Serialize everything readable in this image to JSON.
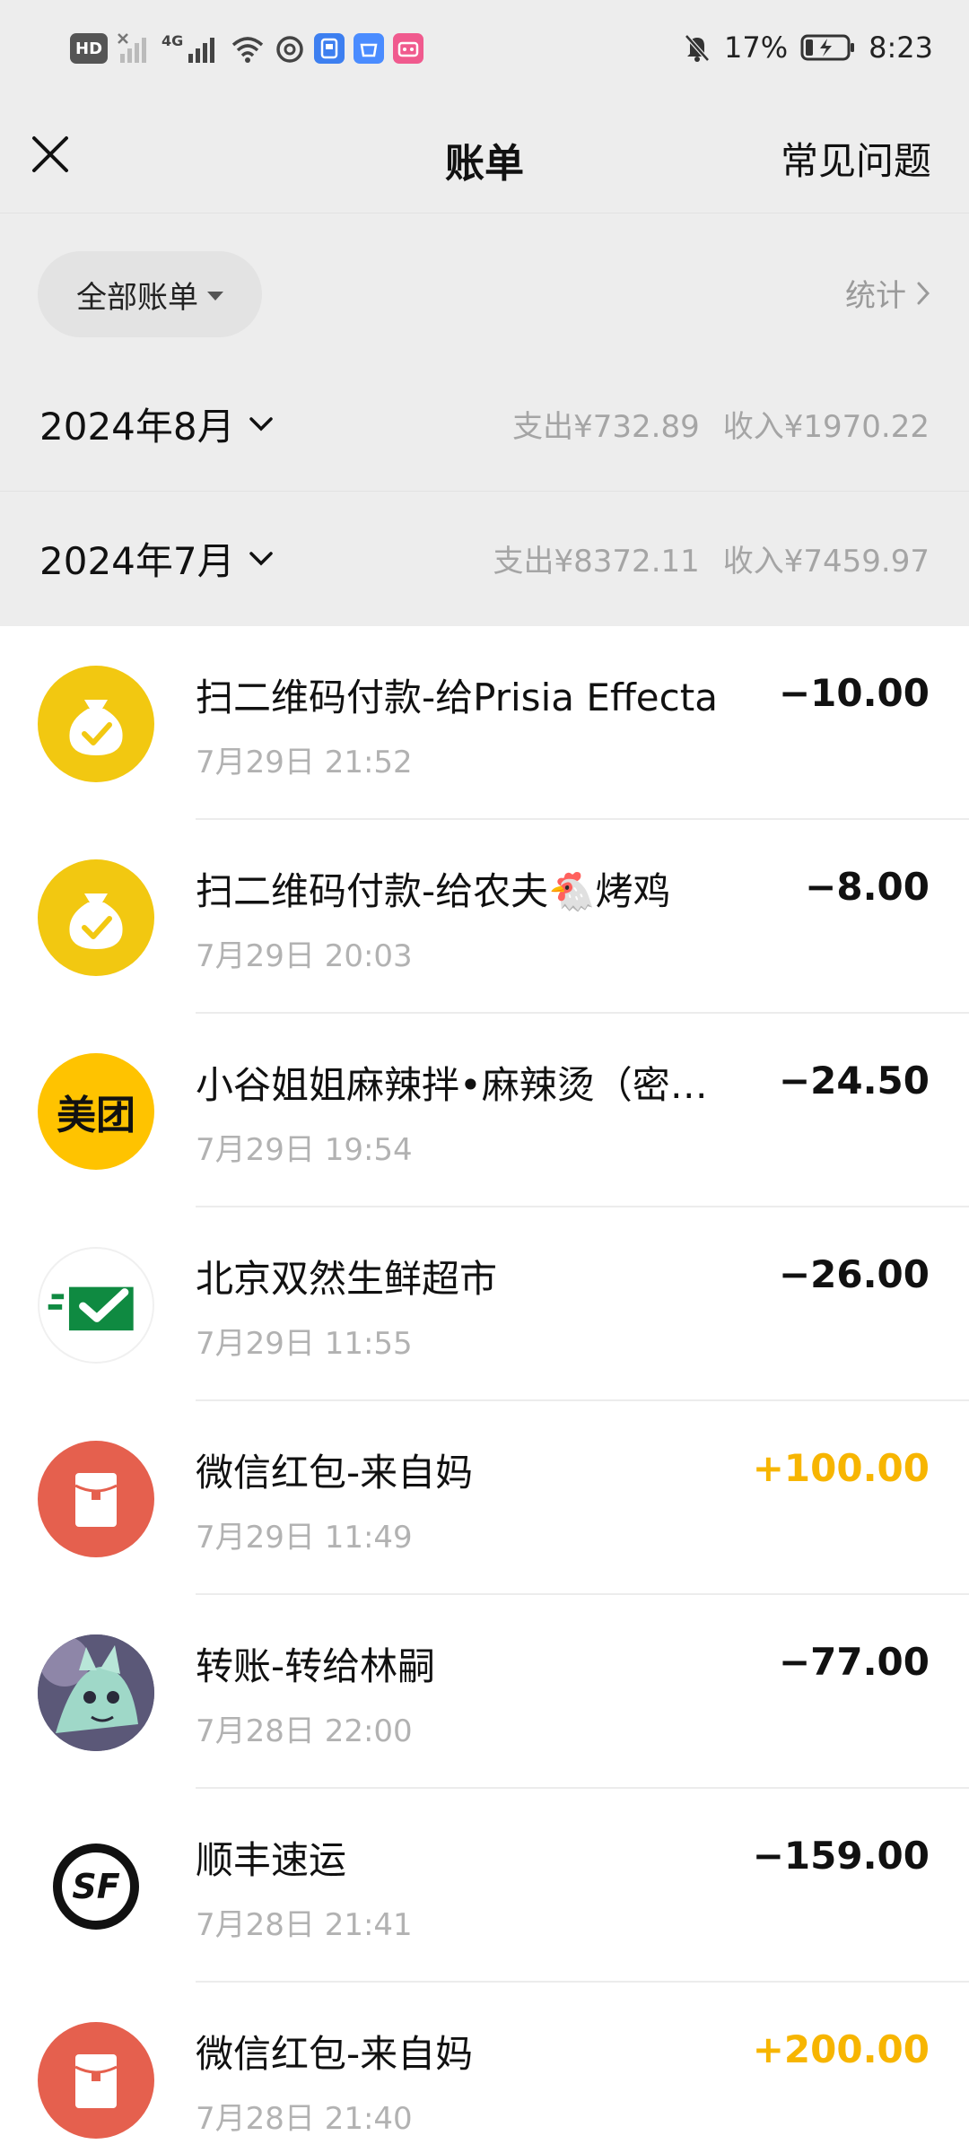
{
  "status_bar": {
    "left_chips": [
      "HD",
      "4G"
    ],
    "battery": "17%",
    "time": "8:23"
  },
  "header": {
    "title": "账单",
    "faq_label": "常见问题"
  },
  "filter": {
    "all_bills_label": "全部账单",
    "stats_label": "统计"
  },
  "months": [
    {
      "label": "2024年8月",
      "expense": "支出¥732.89",
      "income": "收入¥1970.22"
    },
    {
      "label": "2024年7月",
      "expense": "支出¥8372.11",
      "income": "收入¥7459.97"
    }
  ],
  "transactions": [
    {
      "title": "扫二维码付款-给Prisia Effecta",
      "time": "7月29日 21:52",
      "amount": "−10.00",
      "type": "expense",
      "icon": "money-bag-icon"
    },
    {
      "title": "扫二维码付款-给农夫🐔烤鸡",
      "time": "7月29日 20:03",
      "amount": "−8.00",
      "type": "expense",
      "icon": "money-bag-icon"
    },
    {
      "title": "小谷姐姐麻辣拌•麻辣烫（密…",
      "time": "7月29日 19:54",
      "amount": "−24.50",
      "type": "expense",
      "icon": "meituan-logo",
      "logo_text": "美团"
    },
    {
      "title": "北京双然生鲜超市",
      "time": "7月29日 11:55",
      "amount": "−26.00",
      "type": "expense",
      "icon": "green-envelope-check-icon"
    },
    {
      "title": "微信红包-来自妈",
      "time": "7月29日 11:49",
      "amount": "+100.00",
      "type": "income",
      "icon": "red-packet-icon"
    },
    {
      "title": "转账-转给林嗣",
      "time": "7月28日 22:00",
      "amount": "−77.00",
      "type": "expense",
      "icon": "user-avatar"
    },
    {
      "title": "顺丰速运",
      "time": "7月28日 21:41",
      "amount": "−159.00",
      "type": "expense",
      "icon": "sf-express-logo",
      "logo_text": "SF"
    },
    {
      "title": "微信红包-来自妈",
      "time": "7月28日 21:40",
      "amount": "+200.00",
      "type": "income",
      "icon": "red-packet-icon"
    }
  ],
  "colors": {
    "income": "#f7b500",
    "money_bag_bg": "#f2c811",
    "meituan_bg": "#ffc300",
    "red_packet_bg": "#e5604e",
    "envelope_green": "#0f8a41"
  }
}
